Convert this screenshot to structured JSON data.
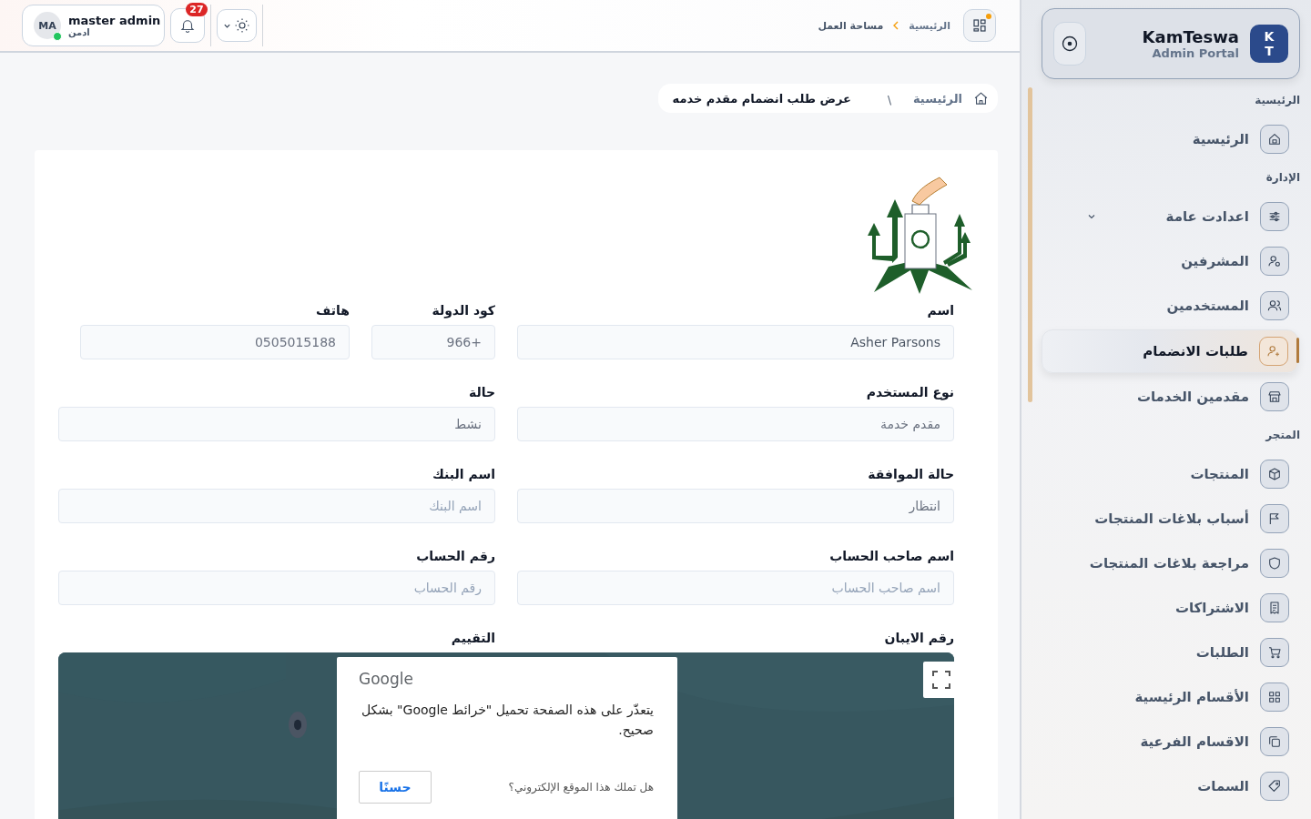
{
  "header": {
    "workspace_dot": true,
    "breadcrumb": [
      "الرئيسية",
      "مساحة العمل"
    ],
    "user": {
      "initials": "MA",
      "name": "master admin",
      "role": "ادمن",
      "online": true
    },
    "notifications": {
      "count": "27"
    }
  },
  "sidebar": {
    "brand": {
      "initials": [
        "K",
        "T"
      ],
      "name": "KamTeswa",
      "subtitle": "Admin Portal"
    },
    "sections": [
      {
        "title": "الرئيسية",
        "items": [
          {
            "label": "الرئيسية",
            "kind": "link",
            "selected": false
          }
        ]
      },
      {
        "title": "الإدارة",
        "items": [
          {
            "label": "اعدادت عامة",
            "kind": "group",
            "selected": false
          },
          {
            "label": "المشرفين",
            "kind": "link",
            "selected": false
          },
          {
            "label": "المستخدمين",
            "kind": "link",
            "selected": false
          },
          {
            "label": "طلبات الانضمام",
            "kind": "link",
            "selected": true
          },
          {
            "label": "مقدمين الخدمات",
            "kind": "link",
            "selected": false
          }
        ]
      },
      {
        "title": "المتجر",
        "items": [
          {
            "label": "المنتجات",
            "kind": "link",
            "selected": false
          },
          {
            "label": "أسباب بلاغات المنتجات",
            "kind": "link",
            "selected": false
          },
          {
            "label": "مراجعة بلاغات المنتجات",
            "kind": "link",
            "selected": false
          },
          {
            "label": "الاشتراكات",
            "kind": "link",
            "selected": false
          },
          {
            "label": "الطلبات",
            "kind": "link",
            "selected": false
          },
          {
            "label": "الأقسام الرئيسية",
            "kind": "link",
            "selected": false
          },
          {
            "label": "الاقسام الفرعية",
            "kind": "link",
            "selected": false
          },
          {
            "label": "السمات",
            "kind": "link",
            "selected": false
          }
        ]
      }
    ]
  },
  "page_breadcrumb": {
    "home": "الرئيسية",
    "separator": "\\",
    "current": "عرض طلب انضمام مقدم خدمه"
  },
  "form": {
    "rows": [
      [
        {
          "label": "اسم",
          "value": "Asher Parsons"
        },
        {
          "label": "كود الدولة",
          "value": "+966"
        },
        {
          "label": "هاتف",
          "value": "0505015188"
        }
      ],
      [
        {
          "label": "نوع المستخدم",
          "value": "مقدم خدمة"
        },
        {
          "label": "حالة",
          "value": "نشط"
        }
      ],
      [
        {
          "label": "حالة الموافقة",
          "value": "انتظار"
        },
        {
          "label": "اسم البنك",
          "placeholder": "اسم البنك"
        }
      ],
      [
        {
          "label": "اسم صاحب الحساب",
          "placeholder": "اسم صاحب الحساب"
        },
        {
          "label": "رقم الحساب",
          "placeholder": "رقم الحساب"
        }
      ]
    ],
    "covered_labels": [
      "رقم الايبان",
      "التقييم"
    ]
  },
  "map": {
    "dialog": {
      "brand": "Google",
      "message": "يتعذّر على هذه الصفحة تحميل \"خرائط Google\" بشكل صحيح.",
      "question": "هل تملك هذا الموقع الإلكتروني؟",
      "ok": "حسنًا"
    }
  }
}
